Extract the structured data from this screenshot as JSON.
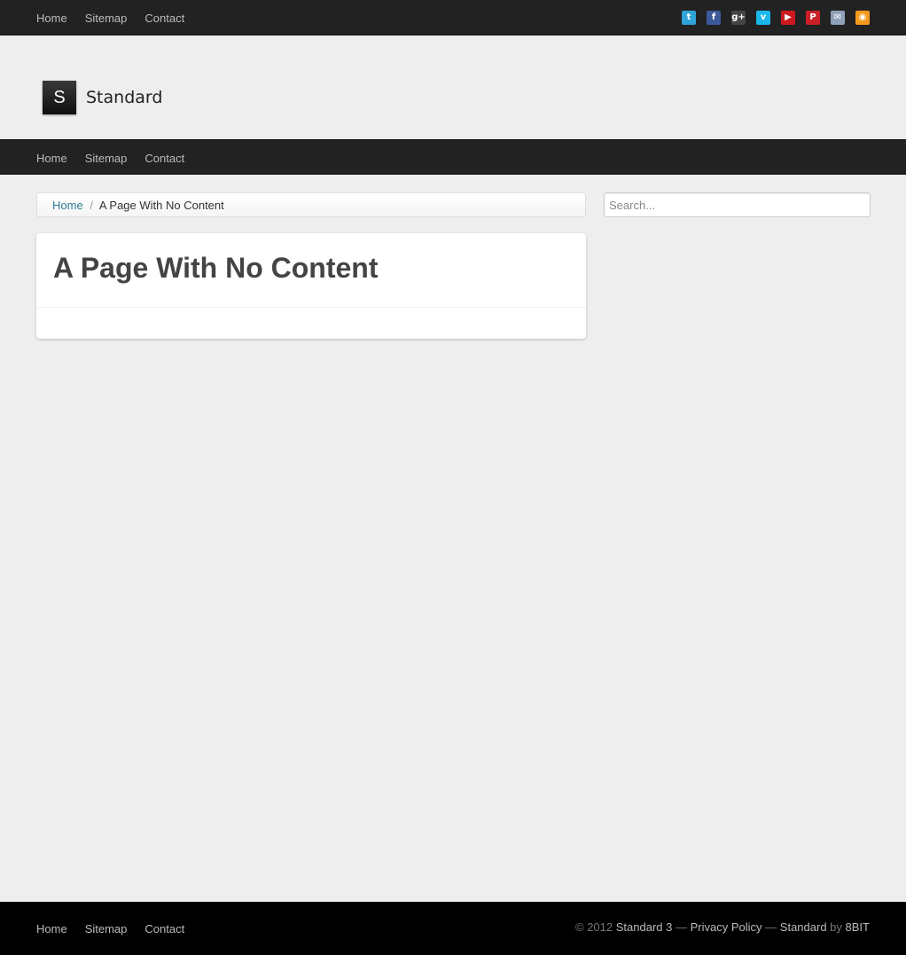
{
  "top_nav": {
    "items": [
      "Home",
      "Sitemap",
      "Contact"
    ]
  },
  "social": [
    {
      "icon": "twitter-icon",
      "glyph": "t",
      "color": "#2fa4d9"
    },
    {
      "icon": "facebook-icon",
      "glyph": "f",
      "color": "#3b5998"
    },
    {
      "icon": "google-plus-icon",
      "glyph": "g+",
      "color": "#444444"
    },
    {
      "icon": "vimeo-icon",
      "glyph": "v",
      "color": "#1ab7ea"
    },
    {
      "icon": "youtube-icon",
      "glyph": "▶",
      "color": "#cc181e"
    },
    {
      "icon": "pinterest-icon",
      "glyph": "P",
      "color": "#cb2027"
    },
    {
      "icon": "email-icon",
      "glyph": "✉",
      "color": "#8ea1b8"
    },
    {
      "icon": "rss-icon",
      "glyph": "◉",
      "color": "#f39a1c"
    }
  ],
  "header": {
    "logo_letter": "S",
    "site_name": "Standard"
  },
  "main_nav": {
    "items": [
      "Home",
      "Sitemap",
      "Contact"
    ]
  },
  "breadcrumb": {
    "home": "Home",
    "separator": "/",
    "current": "A Page With No Content"
  },
  "search": {
    "placeholder": "Search..."
  },
  "post": {
    "title": "A Page With No Content"
  },
  "footer": {
    "nav": [
      "Home",
      "Sitemap",
      "Contact"
    ],
    "copyright": "© 2012",
    "theme": "Standard 3",
    "dash": "—",
    "privacy": "Privacy Policy",
    "theme_name": "Standard",
    "by": "by",
    "author": "8BIT"
  }
}
